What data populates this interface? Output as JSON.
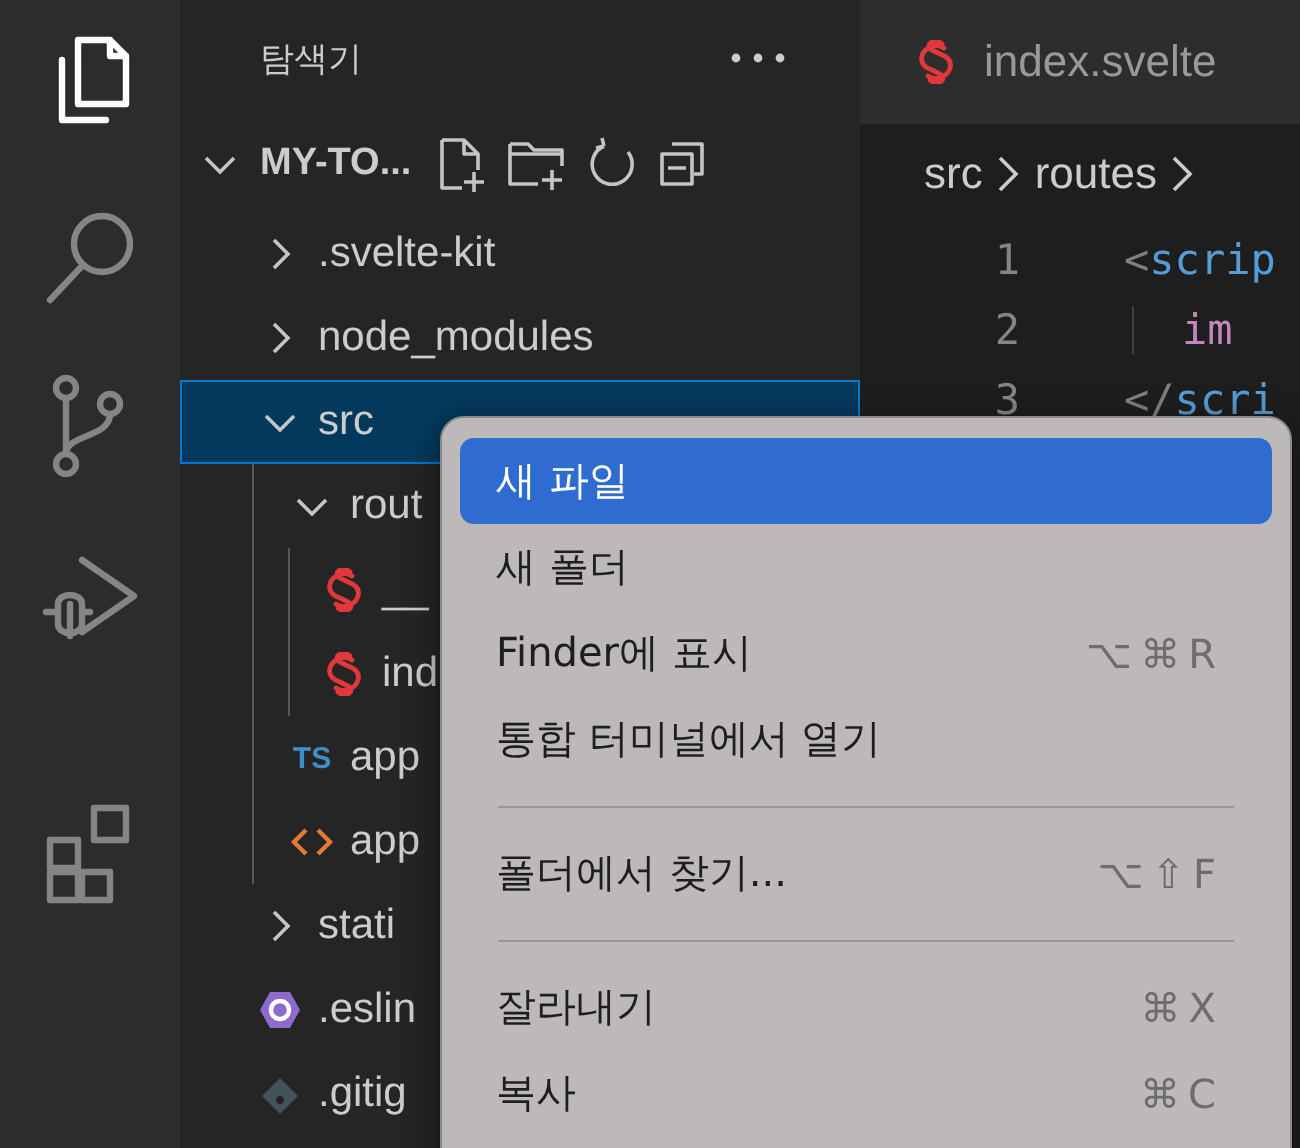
{
  "activity_bar": [
    {
      "kind": "files",
      "selected": true
    },
    {
      "kind": "search",
      "selected": false
    },
    {
      "kind": "source-control",
      "selected": false
    },
    {
      "kind": "run-debug",
      "selected": false
    },
    {
      "kind": "extensions",
      "selected": false
    }
  ],
  "explorer": {
    "title": "탐색기",
    "root": {
      "label": "MY-TO...",
      "expanded": true
    },
    "items": [
      {
        "label": ".svelte-kit",
        "kind": "folder",
        "expanded": false,
        "selected": false
      },
      {
        "label": "node_modules",
        "kind": "folder",
        "expanded": false,
        "selected": false
      },
      {
        "label": "src",
        "kind": "folder",
        "expanded": true,
        "selected": true,
        "children": [
          {
            "label": "rout",
            "kind": "folder",
            "expanded": true,
            "selected": false,
            "children": [
              {
                "label": "__",
                "kind": "svelte",
                "selected": false
              },
              {
                "label": "ind",
                "kind": "svelte",
                "selected": false
              }
            ]
          },
          {
            "label": "app",
            "kind": "ts",
            "badge": "TS",
            "selected": false
          },
          {
            "label": "app",
            "kind": "html",
            "selected": false
          }
        ]
      },
      {
        "label": "stati",
        "kind": "folder",
        "expanded": false,
        "selected": false
      },
      {
        "label": ".eslin",
        "kind": "eslint",
        "selected": false
      },
      {
        "label": ".gitig",
        "kind": "git",
        "selected": false
      }
    ]
  },
  "editor": {
    "tab": {
      "label": "index.svelte"
    },
    "breadcrumbs": [
      "src",
      "routes"
    ],
    "lines": [
      {
        "number": "1",
        "tokens": [
          {
            "kind": "punct",
            "text": "<"
          },
          {
            "kind": "tag",
            "text": "scrip"
          }
        ]
      },
      {
        "number": "2",
        "indent": true,
        "tokens": [
          {
            "kind": "keyword",
            "text": "im"
          }
        ]
      },
      {
        "number": "3",
        "tokens": [
          {
            "kind": "punct",
            "text": "</"
          },
          {
            "kind": "tag",
            "text": "scri"
          }
        ]
      }
    ]
  },
  "context_menu": [
    {
      "kind": "item",
      "label": "새 파일",
      "selected": true
    },
    {
      "kind": "item",
      "label": "새 폴더",
      "selected": false
    },
    {
      "kind": "item",
      "label": "Finder에 표시",
      "shortcut": "⌥⌘R",
      "selected": false
    },
    {
      "kind": "item",
      "label": "통합 터미널에서 열기",
      "selected": false
    },
    {
      "kind": "separator"
    },
    {
      "kind": "item",
      "label": "폴더에서 찾기...",
      "shortcut": "⌥⇧F",
      "selected": false
    },
    {
      "kind": "separator"
    },
    {
      "kind": "item",
      "label": "잘라내기",
      "shortcut": "⌘X",
      "selected": false
    },
    {
      "kind": "item",
      "label": "복사",
      "shortcut": "⌘C",
      "selected": false
    }
  ]
}
